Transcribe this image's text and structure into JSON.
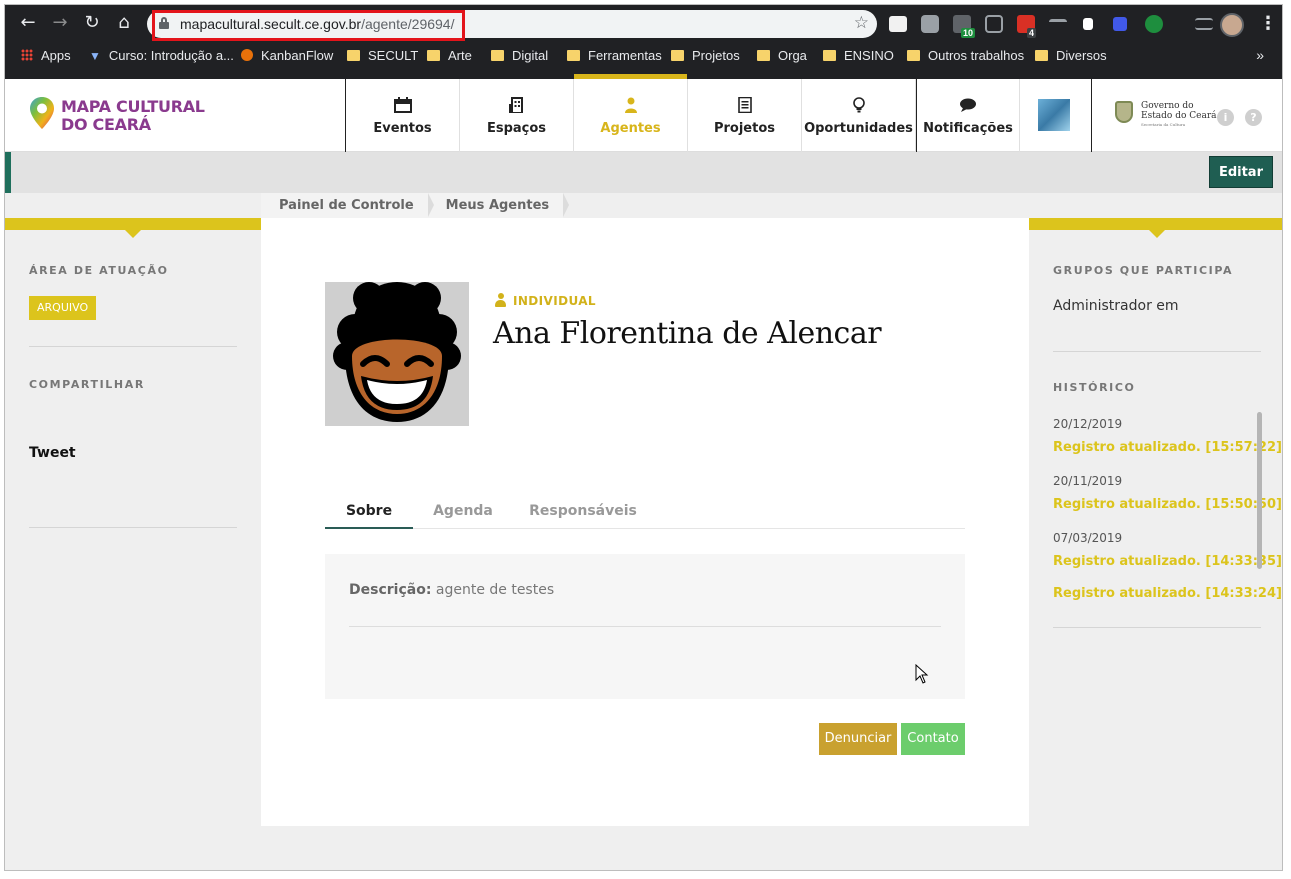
{
  "browser": {
    "url_host": "mapacultural.secult.ce.gov.br",
    "url_path": "/agente/29694/",
    "ext_badge_1": "10",
    "ext_badge_2": "4",
    "bookmarks": [
      "Apps",
      "Curso: Introdução a...",
      "KanbanFlow",
      "SECULT",
      "Arte",
      "Digital",
      "Ferramentas",
      "Projetos",
      "Orga",
      "ENSINO",
      "Outros trabalhos",
      "Diversos"
    ]
  },
  "site": {
    "logo_line1": "MAPA CULTURAL",
    "logo_line2": "DO CEARÁ",
    "nav": [
      "Eventos",
      "Espaços",
      "Agentes",
      "Projetos",
      "Oportunidades",
      "Notificações"
    ],
    "active_nav": "Agentes",
    "gov_line1": "Governo do",
    "gov_line2": "Estado do Ceará",
    "gov_line3": "Secretaria da Cultura",
    "edit_label": "Editar"
  },
  "breadcrumb": [
    "Painel de Controle",
    "Meus Agentes"
  ],
  "left": {
    "area_heading": "ÁREA DE ATUAÇÃO",
    "area_tag": "ARQUIVO",
    "share_heading": "COMPARTILHAR",
    "tweet_label": "Tweet"
  },
  "agent": {
    "type": "INDIVIDUAL",
    "name": "Ana Florentina de Alencar",
    "tabs": [
      "Sobre",
      "Agenda",
      "Responsáveis"
    ],
    "active_tab": "Sobre",
    "description_label": "Descrição:",
    "description": "agente de testes",
    "report_label": "Denunciar",
    "contact_label": "Contato"
  },
  "right": {
    "groups_heading": "GRUPOS QUE PARTICIPA",
    "groups_text": "Administrador em",
    "history_heading": "HISTÓRICO",
    "history": [
      {
        "date": "20/12/2019",
        "text": "Registro atualizado. [15:57:22]"
      },
      {
        "date": "20/11/2019",
        "text": "Registro atualizado. [15:50:50]"
      },
      {
        "date": "07/03/2019",
        "text": "Registro atualizado. [14:33:35]"
      },
      {
        "date": "",
        "text": "Registro atualizado. [14:33:24]"
      }
    ]
  },
  "colors": {
    "accent_yellow": "#dcc41c",
    "edit_green": "#1f5e52",
    "report": "#c9a12f",
    "contact": "#6ccd6c"
  }
}
